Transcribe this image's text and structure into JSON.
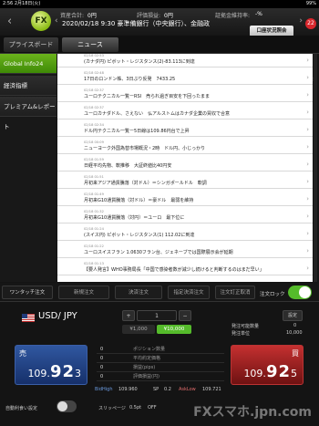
{
  "status_bar": {
    "time": "2:56",
    "date": "2月18日(火)",
    "battery": "99%"
  },
  "header": {
    "logo": "FX",
    "assets_label": "資産合計:",
    "assets_value": "0円",
    "eval_label": "評価損益:",
    "eval_value": "0円",
    "margin_label": "証拠金維持率:",
    "margin_value": "-%",
    "ticker": "2020/02/18 9:30 豪準備銀行（中央銀行）、金融政",
    "account_button": "口座状況照会",
    "notif_count": "22"
  },
  "tabs": [
    {
      "label": "プライスボード"
    },
    {
      "label": "ニュース"
    }
  ],
  "sidebar": [
    {
      "label": "Global Info24"
    },
    {
      "label": "経済指標"
    },
    {
      "label": "プレミアム&レポート"
    }
  ],
  "news": [
    {
      "date": "02/18 02:53",
      "title": "(カナダ円) ピボット・レジスタンス(2)-83.113に到達"
    },
    {
      "date": "02/18 02:48",
      "title": "17日のロンドン株、3日ぶり反発　7433.25"
    },
    {
      "date": "02/18 02:37",
      "title": "ユーロテクニカル一覧ーRSI　売られ過ぎ目安を下回ったまま"
    },
    {
      "date": "02/18 02:37",
      "title": "ユーロカナダドル、さえない　仏アルストムはカナダ企業の買収で合意"
    },
    {
      "date": "02/18 02:34",
      "title": "ドル円テクニカル一覧ー5日線は109.86円台で上昇"
    },
    {
      "date": "02/18 00:09",
      "title": "ニューヨーク外国為替市場概況・2時　ドル円、小じっかり"
    },
    {
      "date": "02/18 01:59",
      "title": "日経平均先物、軟推移　大証終値比40円安"
    },
    {
      "date": "02/18 01:51",
      "title": "月初来アジア通貨騰落（対ドル）＝シンガポールドル　軟調"
    },
    {
      "date": "02/18 01:49",
      "title": "月初来G10通貨騰落（対ドル）＝豪ドル　最弱を維持"
    },
    {
      "date": "02/18 01:32",
      "title": "月初来G10通貨騰落（対円）＝ユーロ　最下位に"
    },
    {
      "date": "02/18 01:24",
      "title": "(スイス円) ピボット・レジスタンス(1) 112.02に到達"
    },
    {
      "date": "02/18 01:22",
      "title": "ユーロスイスフラン 1.0630フラン台、ジェネーブでは国際展示会が延期"
    },
    {
      "date": "02/18 01:13",
      "title": "【要人発言】WHO事務局長「中国で感染者数が減少し続けると判断するのはまだ早い」"
    }
  ],
  "order_bar": {
    "buttons": [
      "ワンタッチ注文",
      "新規注文",
      "決済注文",
      "指定決済注文",
      "注文訂正取消"
    ],
    "lock_label": "注文ロック"
  },
  "trade": {
    "pair": "USD/ JPY",
    "qty_minus": "−",
    "qty_value": "1",
    "qty_plus": "+",
    "lot_1000": "¥1,000",
    "lot_10000": "¥10,000",
    "settings": "設定",
    "max_order_label": "発注可能数量",
    "max_order_value": "0",
    "lot_label": "発注単位",
    "lot_value": "10,000",
    "sell": {
      "label": "売",
      "price_small": "109.",
      "price_big": "92",
      "price_tail": "3"
    },
    "buy": {
      "label": "買",
      "price_small": "109.",
      "price_big": "92",
      "price_tail": "5"
    },
    "positions": [
      {
        "value": "0",
        "key": "ポジション数量"
      },
      {
        "value": "0",
        "key": "平均約定価格"
      },
      {
        "value": "0",
        "key": "損益(pips)"
      },
      {
        "value": "0",
        "key": "評価損益(円)"
      }
    ],
    "bid_label": "BidHigh",
    "bid_value": "109.960",
    "spread_label": "SP",
    "spread_value": "0.2",
    "ask_label": "AskLow",
    "ask_value": "109.721",
    "auto_settle_label": "自動利食い設定",
    "slippage_label": "スリッページ",
    "slippage_value": "0.5pt",
    "slippage_off": "OFF",
    "watermark": "FXスマホ.jpn.com"
  }
}
